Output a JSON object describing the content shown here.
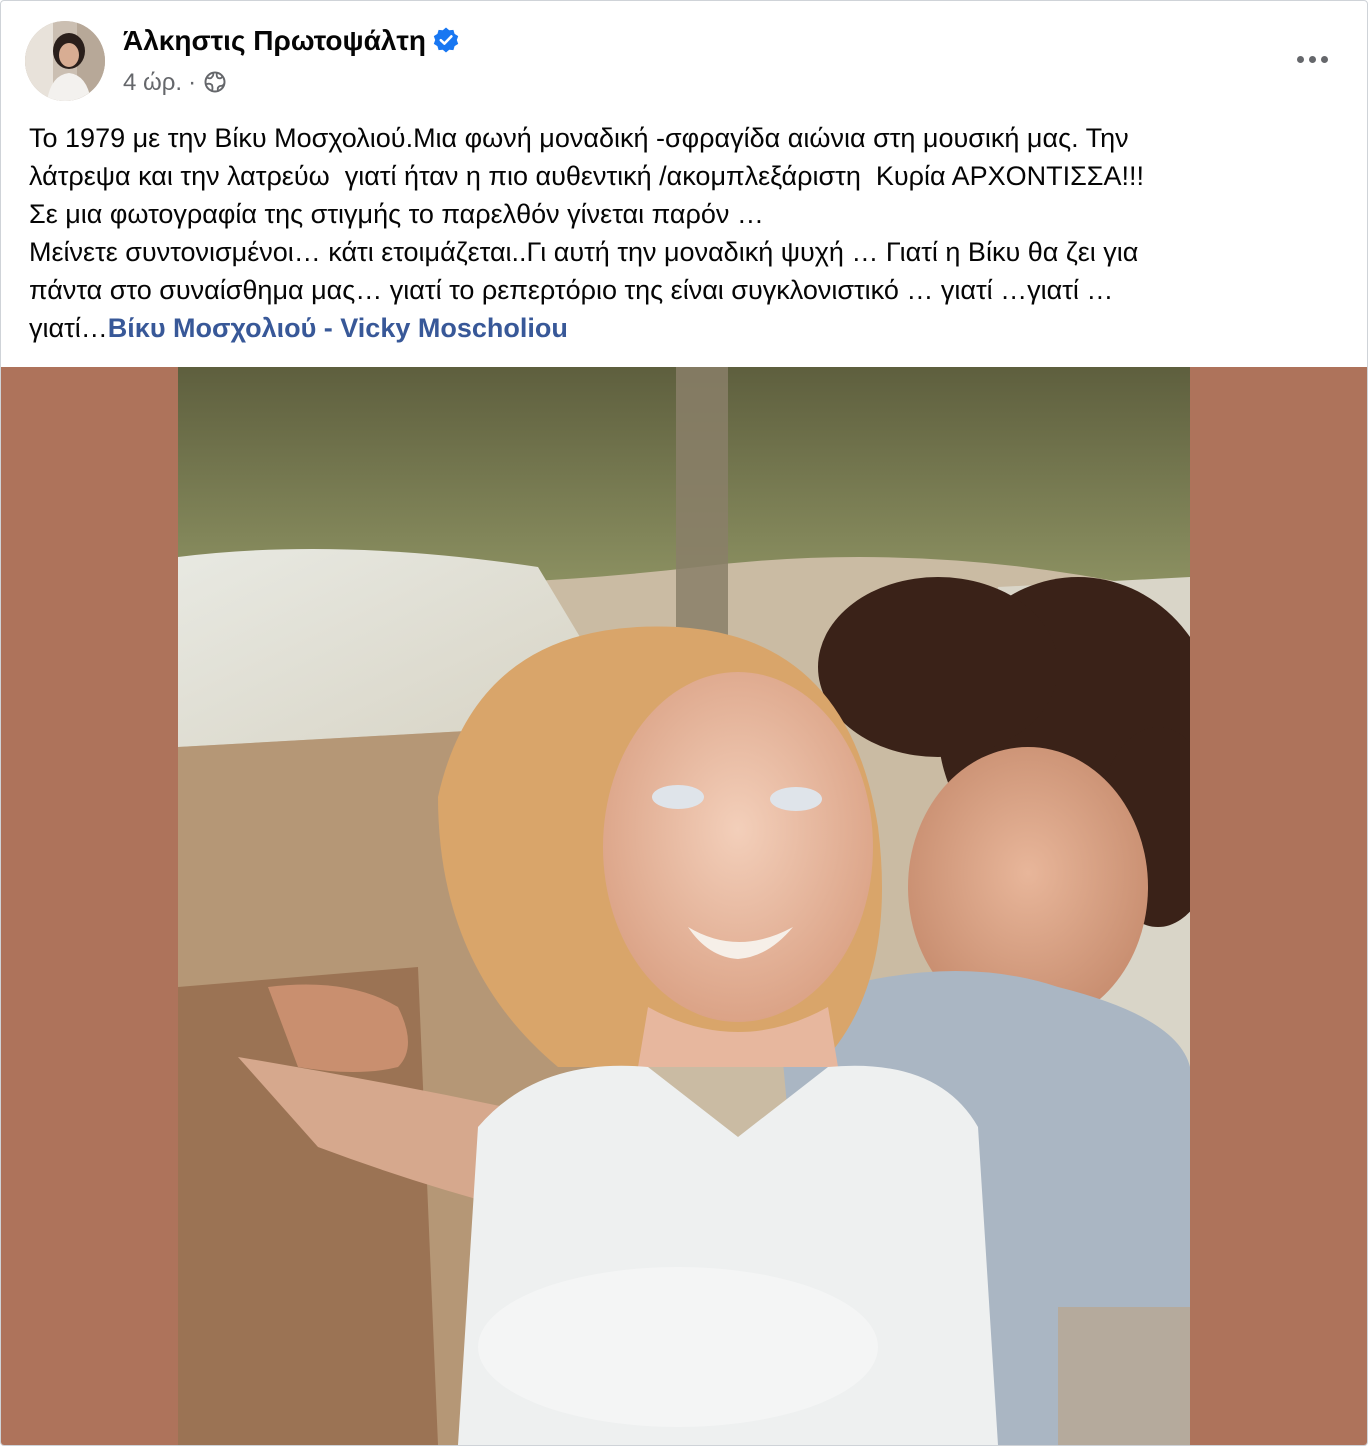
{
  "post": {
    "author": "Άλκηστις Πρωτοψάλτη",
    "verified": true,
    "time": "4 ώρ.",
    "separator": "·",
    "privacy_icon": "globe-icon",
    "more_icon": "more-horizontal-icon",
    "text_lines": [
      "Το 1979 με την Βίκυ Μοσχολιού.Μια φωνή μοναδική -σφραγίδα αιώνια στη μουσική μας. Την",
      "λάτρεψα και την λατρεύω  γιατί ήταν η πιο αυθεντική /ακομπλεξάριστη  Κυρία ΑΡΧΟΝΤΙΣΣΑ!!!",
      "Σε μια φωτογραφία της στιγμής το παρελθόν γίνεται παρόν …",
      "Μείνετε συντονισμένοι… κάτι ετοιμάζεται..Γι αυτή την μοναδική ψυχή … Γιατί η Βίκυ θα ζει για",
      "πάντα στο συναίσθημα μας… γιατί το ρεπερτόριο της είναι συγκλονιστικό … γιατί …γιατί …"
    ],
    "last_line_prefix": "γιατί…",
    "link_text": "Βίκυ Μοσχολιού - Vicky Moscholiou"
  },
  "colors": {
    "link": "#385898",
    "secondary_text": "#65676b",
    "verified_badge": "#1877f2",
    "media_background": "#ae735b"
  }
}
